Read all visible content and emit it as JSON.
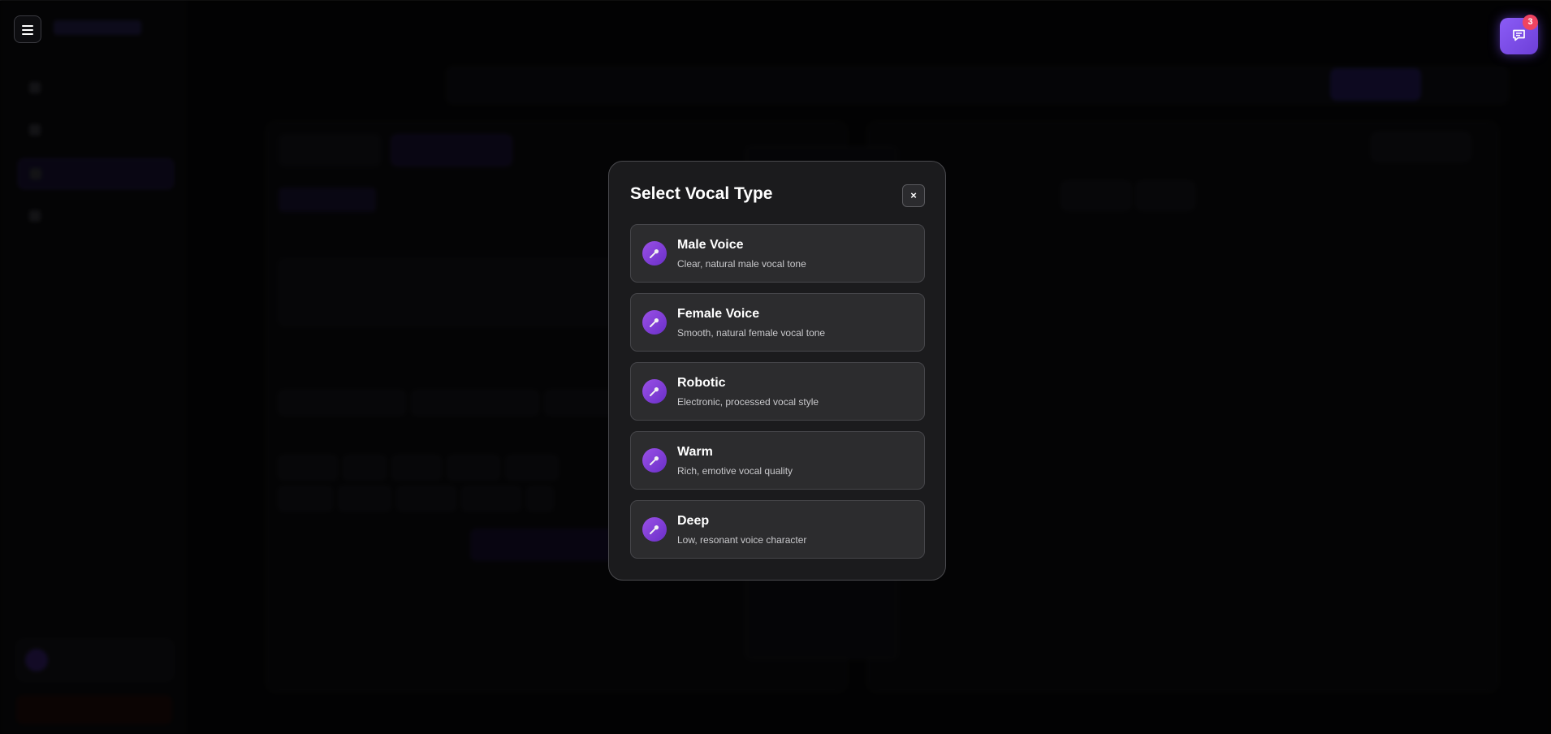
{
  "modal": {
    "title": "Select Vocal Type",
    "close_label": "×",
    "options": [
      {
        "name": "Male Voice",
        "description": "Clear, natural male vocal tone"
      },
      {
        "name": "Female Voice",
        "description": "Smooth, natural female vocal tone"
      },
      {
        "name": "Robotic",
        "description": "Electronic, processed vocal style"
      },
      {
        "name": "Warm",
        "description": "Rich, emotive vocal quality"
      },
      {
        "name": "Deep",
        "description": "Low, resonant voice character"
      }
    ]
  },
  "chat": {
    "badge_count": "3",
    "icon": "chat-icon"
  },
  "menu": {
    "icon": "hamburger-menu-icon"
  },
  "colors": {
    "accent": "#8b5cf6",
    "badge": "#ef4461",
    "modal_bg": "#1b1b1d",
    "option_bg": "#2c2c2e"
  },
  "icons": {
    "option_icon": "microphone-icon"
  }
}
